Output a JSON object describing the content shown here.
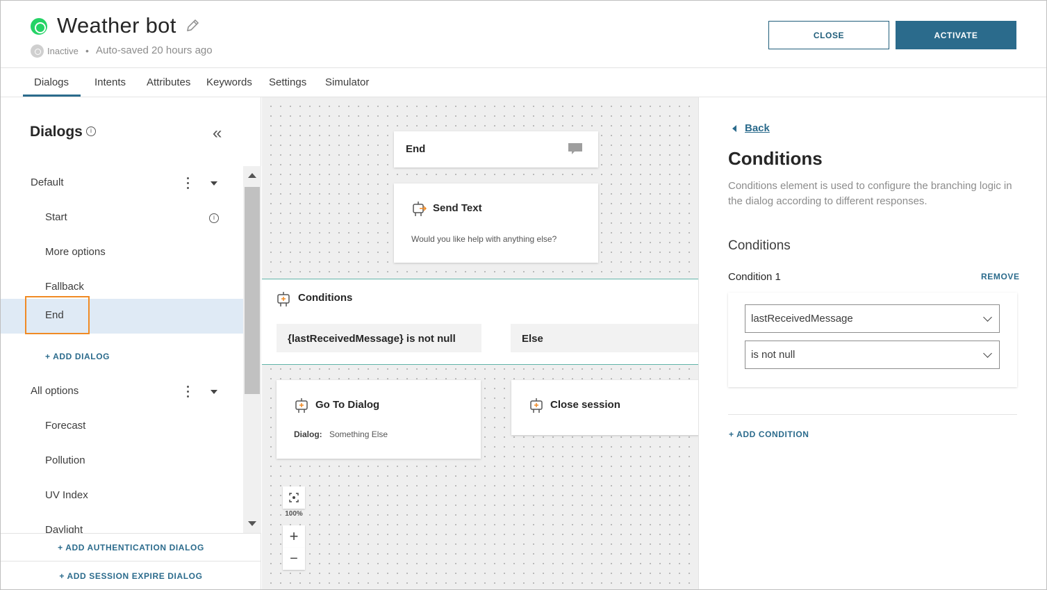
{
  "header": {
    "title": "Weather bot",
    "status": "Inactive",
    "separator": "•",
    "autosaved": "Auto-saved 20 hours ago",
    "close_label": "CLOSE",
    "activate_label": "ACTIVATE"
  },
  "tabs": [
    {
      "label": "Dialogs",
      "active": true
    },
    {
      "label": "Intents"
    },
    {
      "label": "Attributes"
    },
    {
      "label": "Keywords"
    },
    {
      "label": "Settings"
    },
    {
      "label": "Simulator"
    }
  ],
  "sidebar": {
    "title": "Dialogs",
    "info_glyph": "i",
    "collapse_glyph": "«",
    "groups": [
      {
        "label": "Default",
        "items": [
          {
            "label": "Start"
          },
          {
            "label": "More options"
          },
          {
            "label": "Fallback"
          },
          {
            "label": "End",
            "selected": true
          }
        ],
        "add_label": "+ ADD DIALOG"
      },
      {
        "label": "All options",
        "items": [
          {
            "label": "Forecast"
          },
          {
            "label": "Pollution"
          },
          {
            "label": "UV Index"
          },
          {
            "label": "Daylight"
          }
        ]
      }
    ],
    "footer": {
      "add_auth": "+ ADD AUTHENTICATION DIALOG",
      "add_session": "+ ADD SESSION EXPIRE DIALOG"
    }
  },
  "canvas": {
    "end_card": {
      "title": "End"
    },
    "send_text": {
      "title": "Send Text",
      "body": "Would you like help with anything else?"
    },
    "conditions": {
      "title": "Conditions",
      "branch_1": "{lastReceivedMessage} is not null",
      "branch_else": "Else"
    },
    "go_to_dialog": {
      "title": "Go To Dialog",
      "dialog_label": "Dialog:",
      "dialog_value": "Something Else"
    },
    "close_session": {
      "title": "Close session"
    },
    "zoom": {
      "level": "100%",
      "plus": "+",
      "minus": "−"
    }
  },
  "panel": {
    "back_label": "Back",
    "title": "Conditions",
    "description": "Conditions element is used to configure the branching logic in the dialog according to different responses.",
    "section_label": "Conditions",
    "condition_label": "Condition 1",
    "remove_label": "REMOVE",
    "attribute_value": "lastReceivedMessage",
    "operator_value": "is not null",
    "add_condition_label": "+ ADD CONDITION"
  },
  "colors": {
    "accent": "#2b6b8c",
    "whatsapp": "#25d366",
    "selected_row": "#dfeaf5",
    "highlight_outline": "#f08a24",
    "conditions_border": "#5fb3a8"
  }
}
